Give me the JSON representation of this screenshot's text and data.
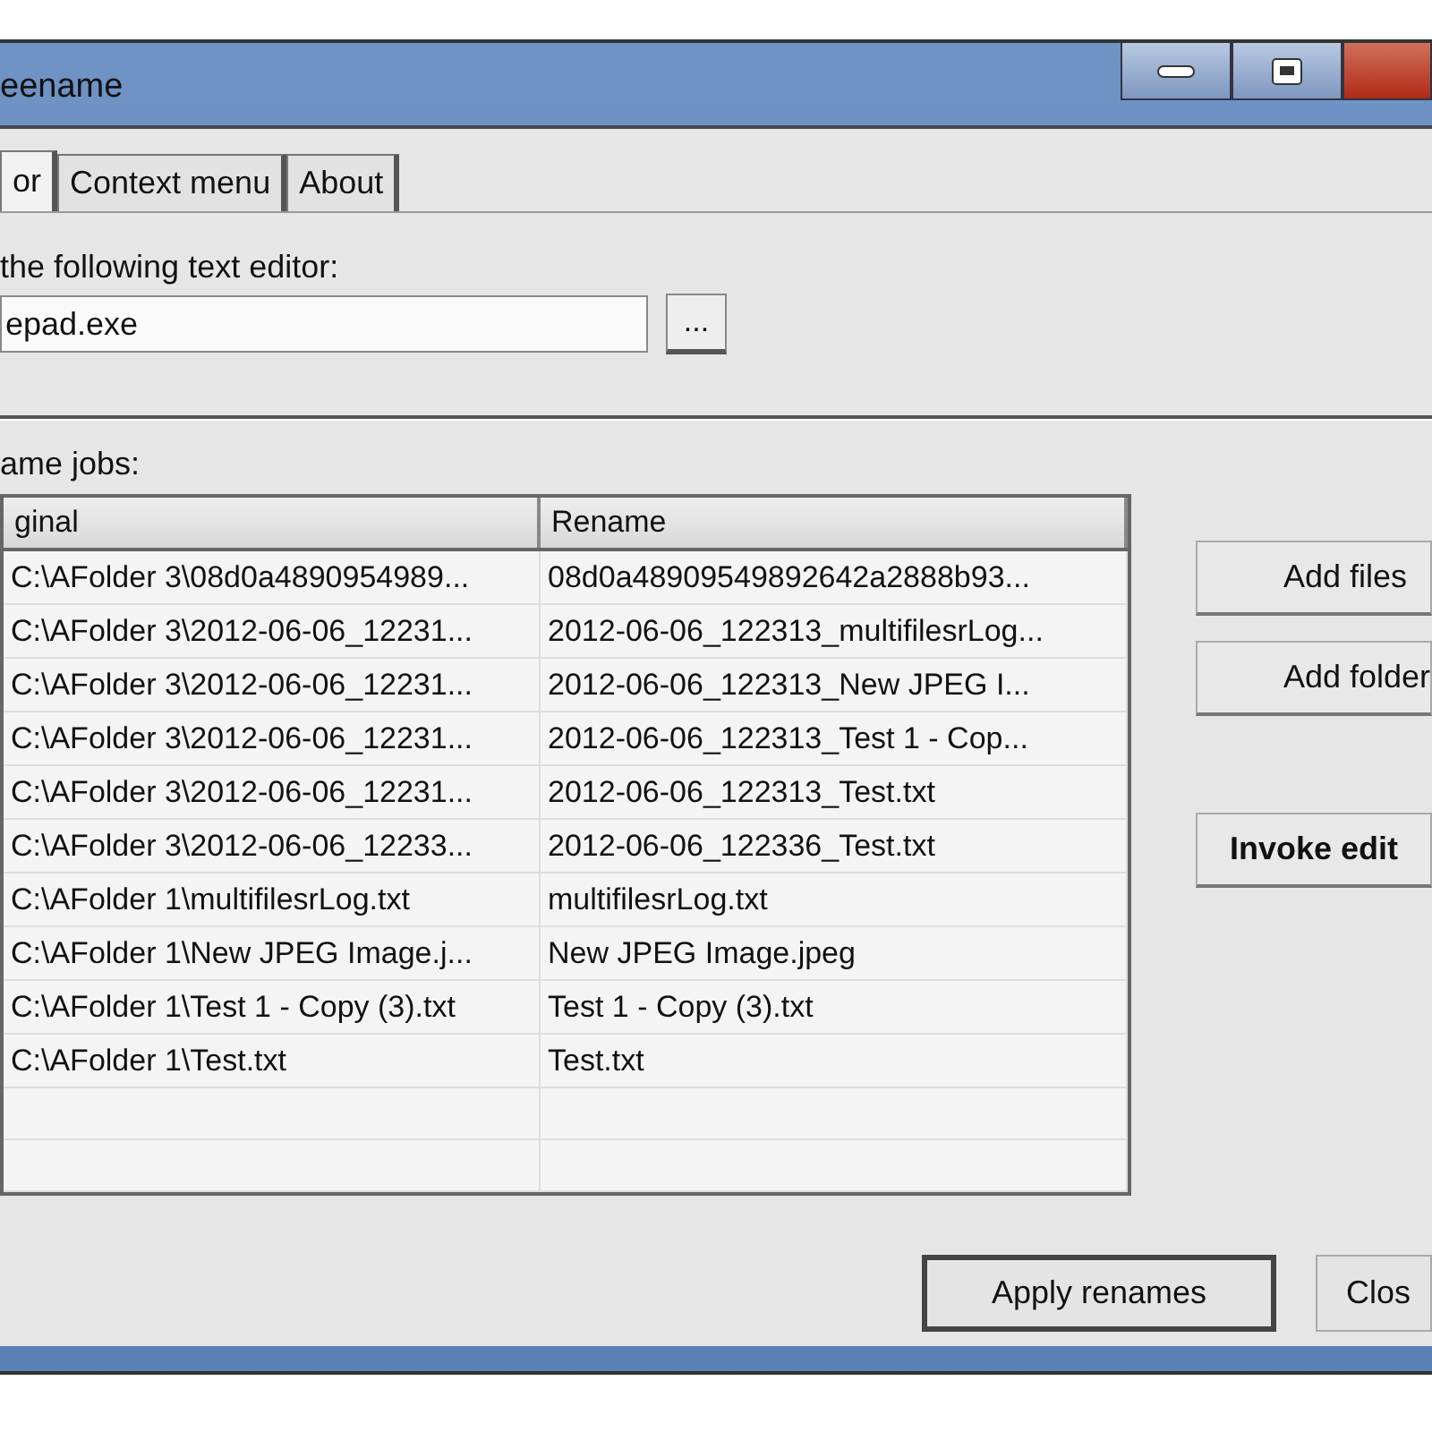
{
  "window": {
    "title": "eename"
  },
  "tabs": [
    {
      "label": "or",
      "selected": true
    },
    {
      "label": "Context menu",
      "selected": false
    },
    {
      "label": "About",
      "selected": false
    }
  ],
  "editor": {
    "label": "the following text editor:",
    "value": "epad.exe",
    "browse": "..."
  },
  "jobs": {
    "label": "ame jobs:",
    "columns": [
      "ginal",
      "Rename"
    ],
    "rows": [
      [
        "C:\\AFolder 3\\08d0a4890954989...",
        "08d0a48909549892642a2888b93..."
      ],
      [
        "C:\\AFolder 3\\2012-06-06_12231...",
        "2012-06-06_122313_multifilesrLog..."
      ],
      [
        "C:\\AFolder 3\\2012-06-06_12231...",
        "2012-06-06_122313_New JPEG I..."
      ],
      [
        "C:\\AFolder 3\\2012-06-06_12231...",
        "2012-06-06_122313_Test 1 - Cop..."
      ],
      [
        "C:\\AFolder 3\\2012-06-06_12231...",
        "2012-06-06_122313_Test.txt"
      ],
      [
        "C:\\AFolder 3\\2012-06-06_12233...",
        "2012-06-06_122336_Test.txt"
      ],
      [
        "C:\\AFolder 1\\multifilesrLog.txt",
        "multifilesrLog.txt"
      ],
      [
        "C:\\AFolder 1\\New JPEG Image.j...",
        "New JPEG Image.jpeg"
      ],
      [
        "C:\\AFolder 1\\Test 1 - Copy (3).txt",
        "Test 1 - Copy (3).txt"
      ],
      [
        "C:\\AFolder 1\\Test.txt",
        "Test.txt"
      ]
    ]
  },
  "side_buttons": [
    {
      "label": "Add files",
      "kind": "normal"
    },
    {
      "label": "Add folder",
      "kind": "normal"
    },
    {
      "label": "Invoke edit",
      "kind": "bold"
    }
  ],
  "bottom_buttons": [
    {
      "label": "Apply renames",
      "kind": "default"
    },
    {
      "label": "Clos",
      "kind": "normal"
    }
  ]
}
